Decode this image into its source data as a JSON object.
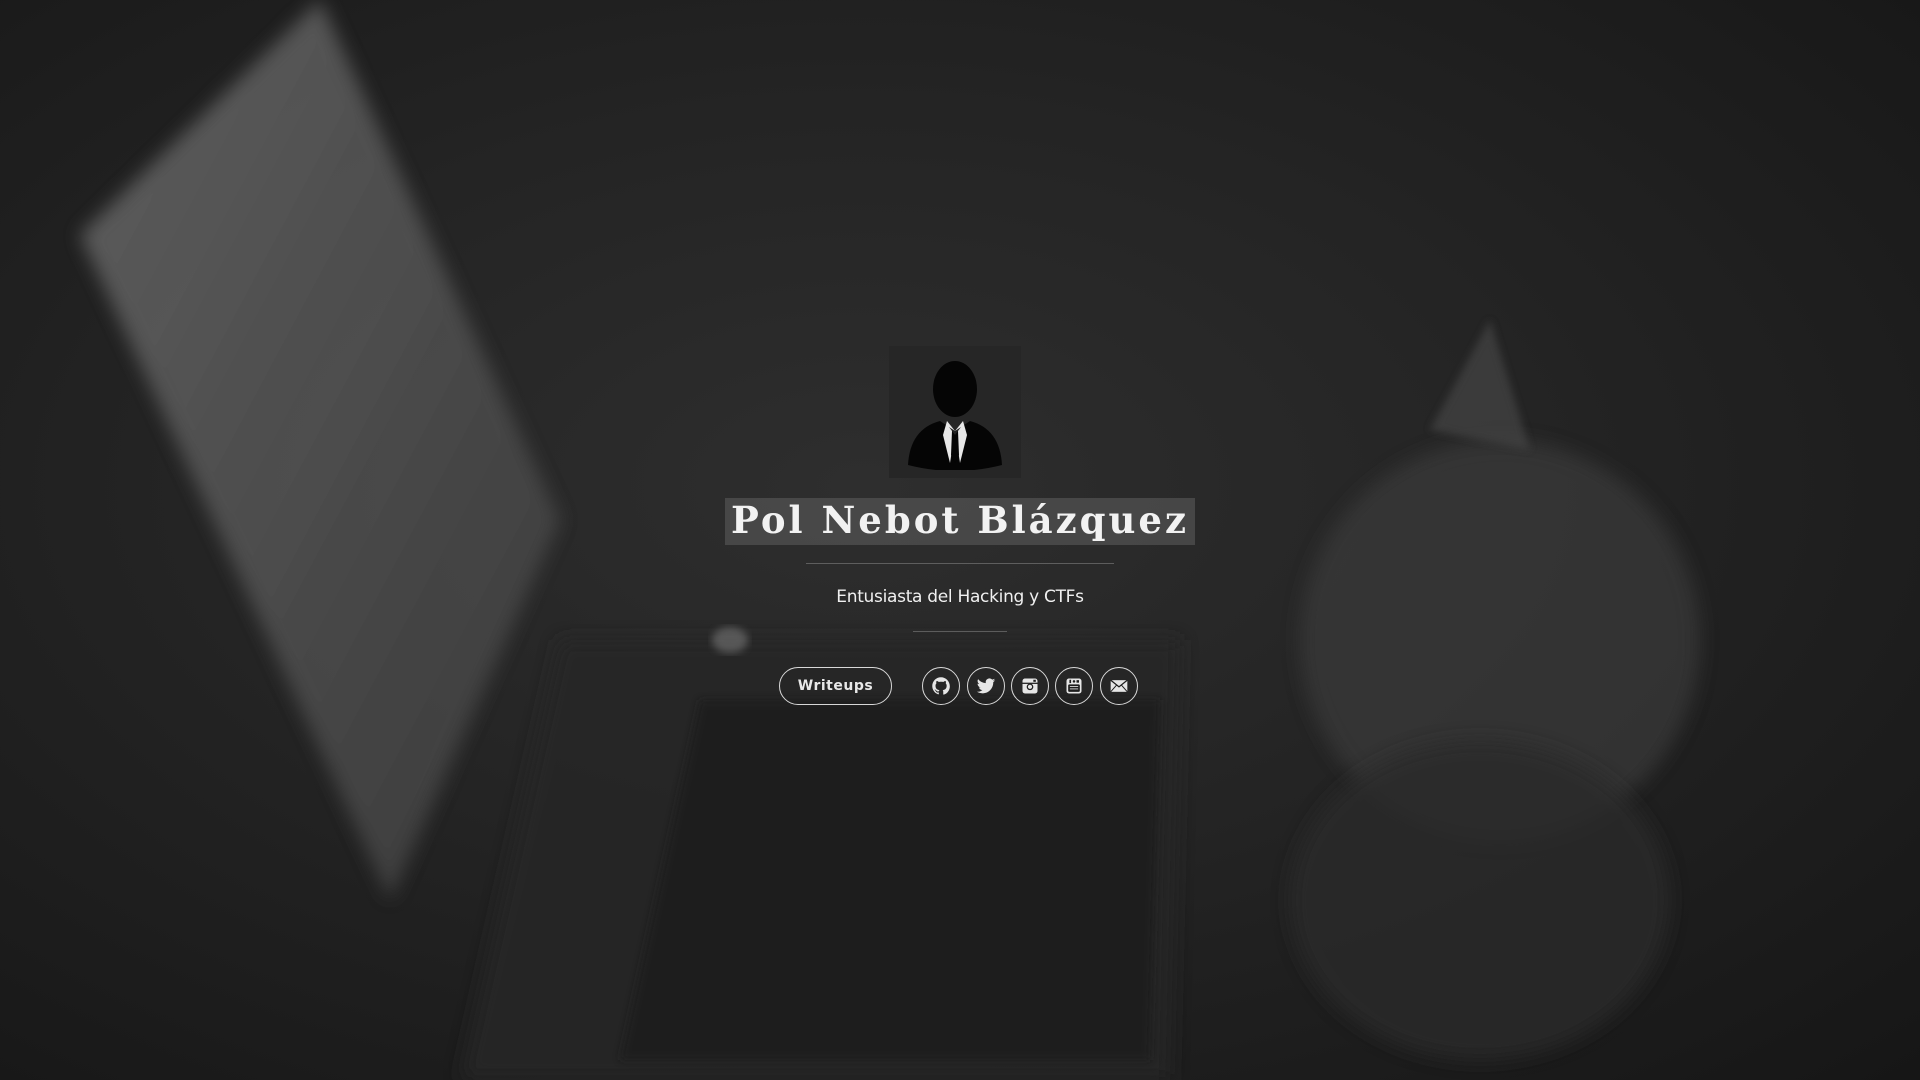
{
  "profile": {
    "name": "Pol Nebot Blázquez",
    "tagline": "Entusiasta del Hacking y CTFs",
    "avatar_icon": "person-silhouette-icon"
  },
  "actions": {
    "writeups_label": "Writeups"
  },
  "social_links": [
    {
      "icon": "github-icon"
    },
    {
      "icon": "twitter-icon"
    },
    {
      "icon": "instagram-icon"
    },
    {
      "icon": "youtube-icon"
    },
    {
      "icon": "email-icon"
    }
  ],
  "colors": {
    "background": "#1e1e1e",
    "text": "#f2f2f2",
    "border": "#d8d8d8"
  }
}
